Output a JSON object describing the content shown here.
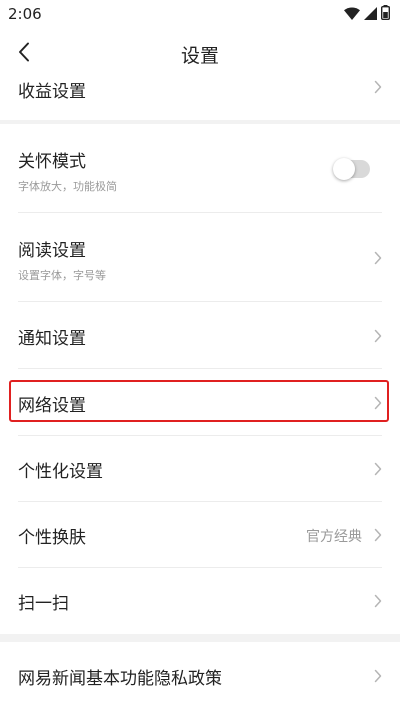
{
  "status_bar": {
    "time": "2:06",
    "icons": [
      "wifi-icon",
      "cellular-signal-icon",
      "battery-icon"
    ]
  },
  "header": {
    "title": "设置",
    "back_icon": "chevron-left-icon"
  },
  "rows": {
    "income": {
      "label": "收益设置"
    },
    "care_mode": {
      "label": "关怀模式",
      "subtitle": "字体放大，功能极简",
      "toggle_on": false
    },
    "reading": {
      "label": "阅读设置",
      "subtitle": "设置字体，字号等"
    },
    "notification": {
      "label": "通知设置"
    },
    "network": {
      "label": "网络设置"
    },
    "personalization": {
      "label": "个性化设置"
    },
    "skin": {
      "label": "个性换肤",
      "value": "官方经典"
    },
    "scan": {
      "label": "扫一扫"
    },
    "privacy": {
      "label": "网易新闻基本功能隐私政策"
    }
  },
  "colors": {
    "highlight_border": "#e02020",
    "background": "#f2f2f2",
    "toggle_off_track": "#d9d9d9"
  }
}
